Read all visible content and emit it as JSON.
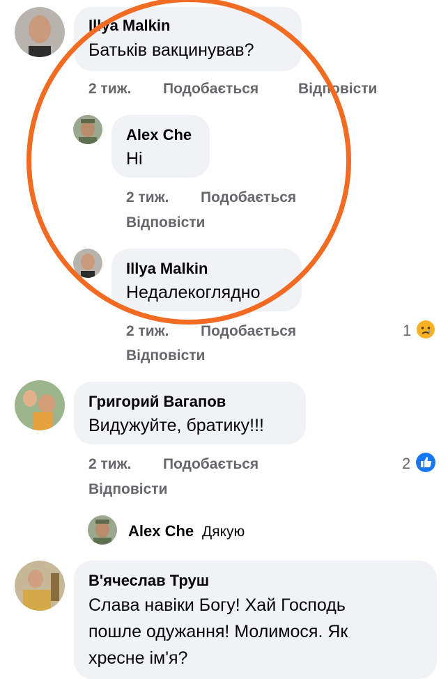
{
  "colors": {
    "bubble": "#f0f2f5",
    "meta": "#65676b",
    "highlight": "#f26b23",
    "like": "#1877f2",
    "sad": "#f7b125"
  },
  "comments": [
    {
      "author": "Illya  Malkin",
      "text": "Батьків вакцинував?",
      "time": "2 тиж.",
      "like": "Подобається",
      "reply": "Відповісти",
      "replies": [
        {
          "author": "Alex Che",
          "text": "Ні",
          "time": "2 тиж.",
          "like": "Подобається",
          "reply": "Відповісти"
        },
        {
          "author": "Illya  Malkin",
          "text": "Недалекоглядно",
          "time": "2 тиж.",
          "like": "Подобається",
          "reply": "Відповісти",
          "reaction_count": "1",
          "reaction_icon": "sad-face-icon"
        }
      ]
    },
    {
      "author": "Григорий Вагапов",
      "text": "Видужуйте, братику!!!",
      "time": "2 тиж.",
      "like": "Подобається",
      "reply": "Відповісти",
      "reaction_count": "2",
      "reaction_icon": "like-icon",
      "reply_preview": {
        "author": "Alex Che",
        "text": "Дякую"
      }
    },
    {
      "author": "В'ячеслав Труш",
      "text_lines": [
        "Слава навіки Богу! Хай Господь",
        "пошле одужання! Молимося. Як",
        "хресне ім'я?"
      ]
    }
  ]
}
